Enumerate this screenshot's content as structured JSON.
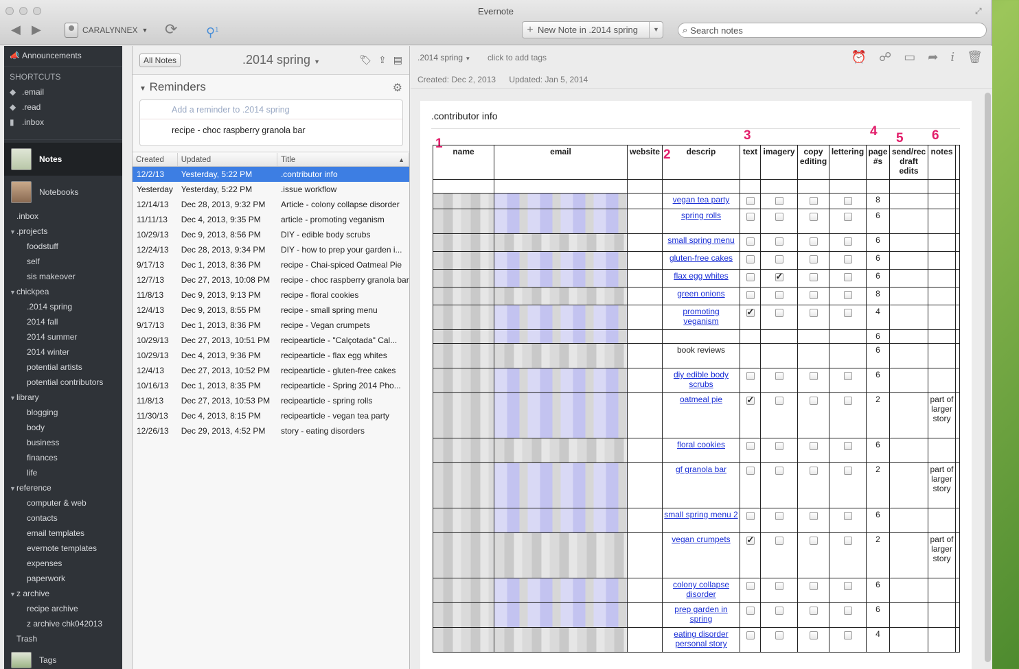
{
  "window": {
    "title": "Evernote"
  },
  "toolbar": {
    "account": "CARALYNNEX",
    "new_note": "New Note in .2014 spring",
    "search_placeholder": "Search notes",
    "badge": "1"
  },
  "sidebar": {
    "announcements": "Announcements",
    "shortcuts_heading": "SHORTCUTS",
    "shortcuts": [
      ".email",
      ".read",
      ".inbox"
    ],
    "notes": "Notes",
    "notebooks": "Notebooks",
    "tree": [
      {
        "label": ".inbox",
        "level": 1
      },
      {
        "label": ".projects",
        "level": 0,
        "stack": true
      },
      {
        "label": "foodstuff",
        "level": 2
      },
      {
        "label": "self",
        "level": 2
      },
      {
        "label": "sis makeover",
        "level": 2
      },
      {
        "label": "chickpea",
        "level": 0,
        "stack": true
      },
      {
        "label": ".2014 spring",
        "level": 2
      },
      {
        "label": "2014 fall",
        "level": 2
      },
      {
        "label": "2014 summer",
        "level": 2
      },
      {
        "label": "2014 winter",
        "level": 2
      },
      {
        "label": "potential artists",
        "level": 2
      },
      {
        "label": "potential contributors",
        "level": 2
      },
      {
        "label": "library",
        "level": 0,
        "stack": true
      },
      {
        "label": "blogging",
        "level": 2
      },
      {
        "label": "body",
        "level": 2
      },
      {
        "label": "business",
        "level": 2
      },
      {
        "label": "finances",
        "level": 2
      },
      {
        "label": "life",
        "level": 2
      },
      {
        "label": "reference",
        "level": 0,
        "stack": true
      },
      {
        "label": "computer & web",
        "level": 2
      },
      {
        "label": "contacts",
        "level": 2
      },
      {
        "label": "email templates",
        "level": 2
      },
      {
        "label": "evernote templates",
        "level": 2
      },
      {
        "label": "expenses",
        "level": 2
      },
      {
        "label": "paperwork",
        "level": 2
      },
      {
        "label": "z archive",
        "level": 0,
        "stack": true
      },
      {
        "label": "recipe archive",
        "level": 2
      },
      {
        "label": "z archive chk042013",
        "level": 2
      },
      {
        "label": "Trash",
        "level": 1
      }
    ],
    "tags": "Tags"
  },
  "notelist": {
    "all_notes": "All Notes",
    "notebook": ".2014 spring",
    "reminders_title": "Reminders",
    "reminder_add": "Add a reminder to .2014 spring",
    "reminder_item": "recipe - choc raspberry granola bar",
    "columns": [
      "Created",
      "Updated",
      "Title"
    ],
    "rows": [
      [
        "12/2/13",
        "Yesterday, 5:22 PM",
        ".contributor info"
      ],
      [
        "Yesterday",
        "Yesterday, 5:22 PM",
        ".issue workflow"
      ],
      [
        "12/14/13",
        "Dec 28, 2013, 9:32 PM",
        "Article - colony collapse disorder"
      ],
      [
        "11/11/13",
        "Dec 4, 2013, 9:35 PM",
        "article - promoting veganism"
      ],
      [
        "10/29/13",
        "Dec 9, 2013, 8:56 PM",
        "DIY - edible body scrubs"
      ],
      [
        "12/24/13",
        "Dec 28, 2013, 9:34 PM",
        "DIY - how to prep your garden i..."
      ],
      [
        "9/17/13",
        "Dec 1, 2013, 8:36 PM",
        "recipe - Chai-spiced Oatmeal Pie"
      ],
      [
        "12/7/13",
        "Dec 27, 2013, 10:08 PM",
        "recipe - choc raspberry granola bar"
      ],
      [
        "11/8/13",
        "Dec 9, 2013, 9:13 PM",
        "recipe - floral cookies"
      ],
      [
        "12/4/13",
        "Dec 9, 2013, 8:55 PM",
        "recipe - small spring menu"
      ],
      [
        "9/17/13",
        "Dec 1, 2013, 8:36 PM",
        "recipe - Vegan crumpets"
      ],
      [
        "10/29/13",
        "Dec 27, 2013, 10:51 PM",
        "recipearticle - \"Calçotada\" Cal..."
      ],
      [
        "10/29/13",
        "Dec 4, 2013, 9:36 PM",
        "recipearticle - flax egg whites"
      ],
      [
        "12/4/13",
        "Dec 27, 2013, 10:52 PM",
        "recipearticle - gluten-free cakes"
      ],
      [
        "10/16/13",
        "Dec 1, 2013, 8:35 PM",
        "recipearticle - Spring 2014 Pho..."
      ],
      [
        "11/8/13",
        "Dec 27, 2013, 10:53 PM",
        "recipearticle - spring rolls"
      ],
      [
        "11/30/13",
        "Dec 4, 2013, 8:15 PM",
        "recipearticle - vegan tea party"
      ],
      [
        "12/26/13",
        "Dec 29, 2013, 4:52 PM",
        "story - eating disorders"
      ]
    ]
  },
  "note": {
    "notebook": ".2014 spring",
    "tags_hint": "click to add tags",
    "created": "Created: Dec 2, 2013",
    "updated": "Updated: Jan 5, 2014",
    "title": ".contributor info",
    "marks": [
      "1",
      "2",
      "3",
      "4",
      "5",
      "6"
    ],
    "columns": [
      "name",
      "email",
      "website",
      "descrip",
      "text",
      "imagery",
      "copy editing",
      "lettering",
      "page #s",
      "send/rec draft edits",
      "notes"
    ],
    "rows": [
      {
        "descrip": "",
        "text": null,
        "imagery": null,
        "copy": null,
        "lettering": null,
        "page": "",
        "notes": "",
        "link": false
      },
      {
        "descrip": "vegan tea party",
        "text": false,
        "imagery": false,
        "copy": false,
        "lettering": false,
        "page": "8",
        "notes": "",
        "link": true
      },
      {
        "descrip": "spring rolls",
        "text": false,
        "imagery": false,
        "copy": false,
        "lettering": false,
        "page": "6",
        "notes": "",
        "link": true
      },
      {
        "descrip": "small spring menu",
        "text": false,
        "imagery": false,
        "copy": false,
        "lettering": false,
        "page": "6",
        "notes": "",
        "link": true
      },
      {
        "descrip": "gluten-free cakes",
        "text": false,
        "imagery": false,
        "copy": false,
        "lettering": false,
        "page": "6",
        "notes": "",
        "link": true
      },
      {
        "descrip": "flax egg whites",
        "text": false,
        "imagery": true,
        "copy": false,
        "lettering": false,
        "page": "6",
        "notes": "",
        "link": true
      },
      {
        "descrip": "green onions",
        "text": false,
        "imagery": false,
        "copy": false,
        "lettering": false,
        "page": "8",
        "notes": "",
        "link": true
      },
      {
        "descrip": "promoting veganism",
        "text": true,
        "imagery": false,
        "copy": false,
        "lettering": false,
        "page": "4",
        "notes": "",
        "link": true
      },
      {
        "descrip": "",
        "text": null,
        "imagery": null,
        "copy": null,
        "lettering": null,
        "page": "6",
        "notes": "",
        "link": false
      },
      {
        "descrip": "book reviews",
        "text": null,
        "imagery": null,
        "copy": null,
        "lettering": null,
        "page": "6",
        "notes": "",
        "link": false
      },
      {
        "descrip": "diy edible body scrubs",
        "text": false,
        "imagery": false,
        "copy": false,
        "lettering": false,
        "page": "6",
        "notes": "",
        "link": true
      },
      {
        "descrip": "oatmeal pie",
        "text": true,
        "imagery": false,
        "copy": false,
        "lettering": false,
        "page": "2",
        "notes": "part of larger story",
        "link": true
      },
      {
        "descrip": "floral cookies",
        "text": false,
        "imagery": false,
        "copy": false,
        "lettering": false,
        "page": "6",
        "notes": "",
        "link": true
      },
      {
        "descrip": "gf granola bar",
        "text": false,
        "imagery": false,
        "copy": false,
        "lettering": false,
        "page": "2",
        "notes": "part of larger story",
        "link": true
      },
      {
        "descrip": "small spring menu 2",
        "text": false,
        "imagery": false,
        "copy": false,
        "lettering": false,
        "page": "6",
        "notes": "",
        "link": true
      },
      {
        "descrip": "vegan crumpets",
        "text": true,
        "imagery": false,
        "copy": false,
        "lettering": false,
        "page": "2",
        "notes": "part of larger story",
        "link": true
      },
      {
        "descrip": "colony collapse disorder",
        "text": false,
        "imagery": false,
        "copy": false,
        "lettering": false,
        "page": "6",
        "notes": "",
        "link": true
      },
      {
        "descrip": "prep garden in spring",
        "text": false,
        "imagery": false,
        "copy": false,
        "lettering": false,
        "page": "6",
        "notes": "",
        "link": true
      },
      {
        "descrip": "eating disorder personal story",
        "text": false,
        "imagery": false,
        "copy": false,
        "lettering": false,
        "page": "4",
        "notes": "",
        "link": true
      }
    ]
  }
}
